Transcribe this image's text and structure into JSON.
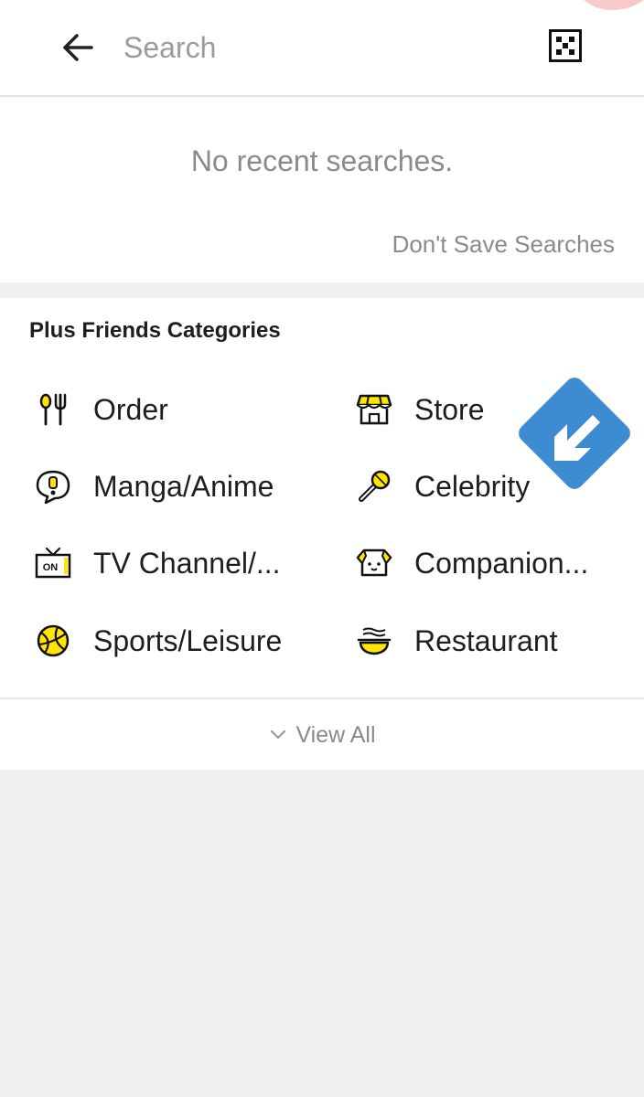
{
  "header": {
    "search_placeholder": "Search",
    "icons": {
      "back": "arrow-left-icon",
      "qr": "qr-code-icon"
    }
  },
  "recent": {
    "empty_text": "No recent searches.",
    "dont_save_label": "Don't Save Searches"
  },
  "categories": {
    "title": "Plus Friends Categories",
    "items": [
      {
        "label": "Order",
        "icon": "spoon-fork-icon"
      },
      {
        "label": "Store",
        "icon": "storefront-icon"
      },
      {
        "label": "Manga/Anime",
        "icon": "speech-bubble-exclamation-icon"
      },
      {
        "label": "Celebrity",
        "icon": "microphone-icon"
      },
      {
        "label": "TV Channel/...",
        "icon": "tv-on-icon"
      },
      {
        "label": "Companion...",
        "icon": "dog-face-icon"
      },
      {
        "label": "Sports/Leisure",
        "icon": "basketball-icon"
      },
      {
        "label": "Restaurant",
        "icon": "noodle-bowl-icon"
      }
    ],
    "view_all_label": "View All"
  },
  "colors": {
    "accent_yellow": "#ffe600",
    "overlay_blue": "#3d8bd0",
    "text_gray": "#8a8a8a",
    "background": "#f0f0f0"
  }
}
